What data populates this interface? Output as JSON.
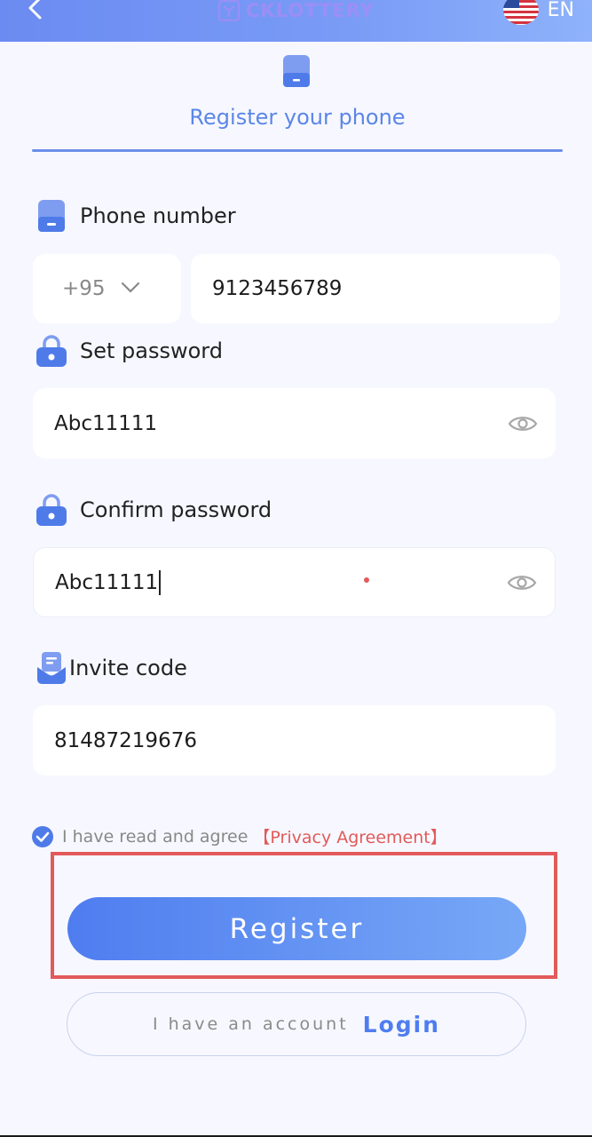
{
  "header": {
    "logo_text": "CKLOTTERY",
    "language": "EN"
  },
  "tab": {
    "label": "Register your phone"
  },
  "form": {
    "phone_label": "Phone number",
    "country_code": "+95",
    "phone_value": "9123456789",
    "password_label": "Set password",
    "password_value": "Abc11111",
    "confirm_label": "Confirm password",
    "confirm_value": "Abc11111",
    "invite_label": "Invite code",
    "invite_value": "81487219676"
  },
  "agreement": {
    "text": "I have read and agree",
    "link": "【Privacy Agreement】",
    "checked": true
  },
  "buttons": {
    "register": "Register",
    "login_prefix": "I have an account",
    "login": "Login"
  },
  "colors": {
    "accent": "#4f7df0",
    "link_red": "#e25a5a",
    "highlight": "#e25a5a"
  },
  "icons": {
    "back": "chevron-left-icon",
    "language": "us-flag-icon",
    "phone": "phone-icon",
    "password": "lock-icon",
    "invite": "invite-icon",
    "visibility": "eye-icon",
    "dropdown": "chevron-down-icon",
    "agreement": "checkmark-icon"
  }
}
